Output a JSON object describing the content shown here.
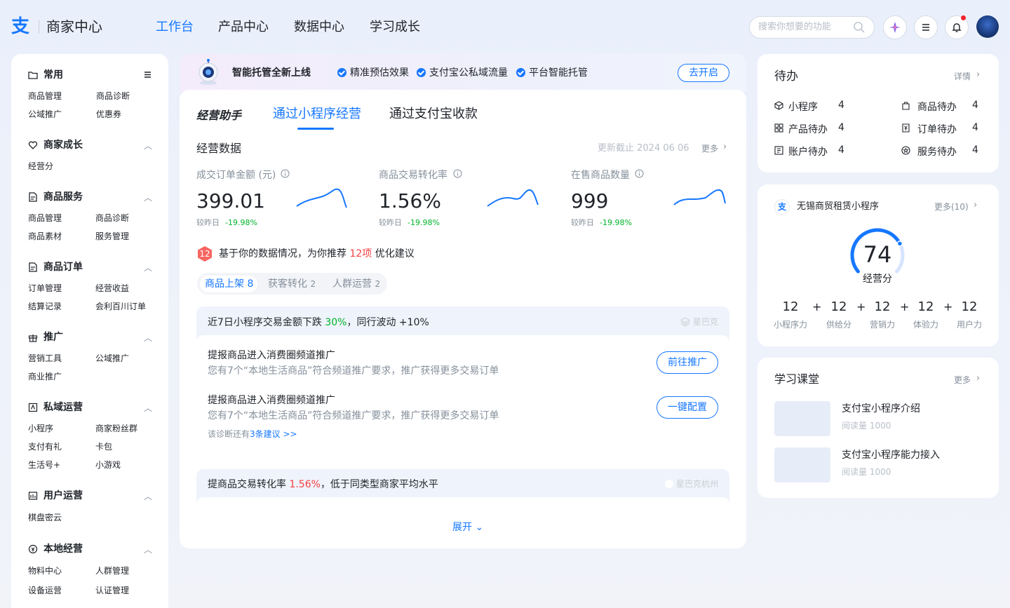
{
  "header": {
    "logo_text": "商家中心",
    "nav": [
      "工作台",
      "产品中心",
      "数据中心",
      "学习成长"
    ],
    "search_placeholder": "搜索你想要的功能"
  },
  "sidebar": {
    "sections": [
      {
        "title": "常用",
        "items": [
          "商品管理",
          "商品诊断",
          "公域推广",
          "优惠券"
        ]
      },
      {
        "title": "商家成长",
        "items": [
          "经营分"
        ]
      },
      {
        "title": "商品服务",
        "items": [
          "商品管理",
          "商品诊断",
          "商品素材",
          "服务管理"
        ]
      },
      {
        "title": "商品订单",
        "items": [
          "订单管理",
          "经营收益",
          "结算记录",
          "会利百川订单"
        ]
      },
      {
        "title": "推广",
        "items": [
          "营销工具",
          "公域推广",
          "商业推广"
        ]
      },
      {
        "title": "私域运营",
        "items": [
          "小程序",
          "商家粉丝群",
          "支付有礼",
          "卡包",
          "生活号+",
          "小游戏"
        ]
      },
      {
        "title": "用户运营",
        "items": [
          "棋盘密云"
        ]
      },
      {
        "title": "本地经营",
        "items": [
          "物料中心",
          "人群管理",
          "设备运营",
          "认证管理"
        ]
      }
    ]
  },
  "banner": {
    "title": "智能托管全新上线",
    "features": [
      "精准预估效果",
      "支付宝公私域流量",
      "平台智能托管"
    ],
    "button": "去开启"
  },
  "main": {
    "tabs": [
      "经营助手",
      "通过小程序经营",
      "通过支付宝收款"
    ],
    "section_title": "经营数据",
    "updated": "更新截止 2024 06 06",
    "more": "更多",
    "metrics": [
      {
        "label": "成交订单金额 (元)",
        "value": "399.01",
        "cmp_label": "较昨日",
        "cmp_value": "-19.98%"
      },
      {
        "label": "商品交易转化率",
        "value": "1.56%",
        "cmp_label": "较昨日",
        "cmp_value": "-19.98%"
      },
      {
        "label": "在售商品数量",
        "value": "999",
        "cmp_label": "较昨日",
        "cmp_value": "-19.98%"
      }
    ],
    "rec_badge": "12",
    "rec_text_a": "基于你的数据情况，为你推荐 ",
    "rec_count": "12项",
    "rec_text_b": " 优化建议",
    "chips": [
      {
        "label": "商品上架",
        "count": "8"
      },
      {
        "label": "获客转化",
        "count": "2"
      },
      {
        "label": "人群运营",
        "count": "2"
      }
    ],
    "diag1": {
      "title_a": "近7日小程序交易金额下跌 ",
      "title_hl": "30%",
      "title_b": "，同行波动 +10%",
      "shop": "星巴克",
      "rows": [
        {
          "title": "提报商品进入消费圈频道推广",
          "desc": "您有7个“本地生活商品”符合频道推广要求，推广获得更多交易订单",
          "button": "前往推广"
        },
        {
          "title": "提报商品进入消费圈频道推广",
          "desc": "您有7个“本地生活商品”符合频道推广要求，推广获得更多交易订单",
          "button": "一键配置"
        }
      ],
      "tip_a": "该诊断还有",
      "tip_link": "3条建议 >>"
    },
    "diag2": {
      "title_a": "提商品交易转化率 ",
      "title_hl": "1.56%",
      "title_b": "，低于同类型商家平均水平",
      "shop": "星巴克杭州"
    },
    "expand": "展开"
  },
  "todo": {
    "title": "待办",
    "more": "详情",
    "items": [
      {
        "label": "小程序",
        "count": "4"
      },
      {
        "label": "商品待办",
        "count": "4"
      },
      {
        "label": "产品待办",
        "count": "4"
      },
      {
        "label": "订单待办",
        "count": "4"
      },
      {
        "label": "账户待办",
        "count": "4"
      },
      {
        "label": "服务待办",
        "count": "4"
      }
    ]
  },
  "miniapp": {
    "name": "无锡商贸租赁小程序",
    "more": "更多(10)",
    "score": "74",
    "score_label": "经营分",
    "score_level": 0.74,
    "subs": [
      {
        "value": "12",
        "label": "小程序力"
      },
      {
        "value": "12",
        "label": "供给分"
      },
      {
        "value": "12",
        "label": "营销力"
      },
      {
        "value": "12",
        "label": "体验力"
      },
      {
        "value": "12",
        "label": "用户力"
      }
    ]
  },
  "learn": {
    "title": "学习课堂",
    "more": "更多",
    "items": [
      {
        "title": "支付宝小程序介绍",
        "meta": "阅读量 1000"
      },
      {
        "title": "支付宝小程序能力接入",
        "meta": "阅读量 1000"
      }
    ]
  },
  "colors": {
    "primary": "#1677ff",
    "danger": "#f53f3f",
    "success": "#00b42a"
  }
}
